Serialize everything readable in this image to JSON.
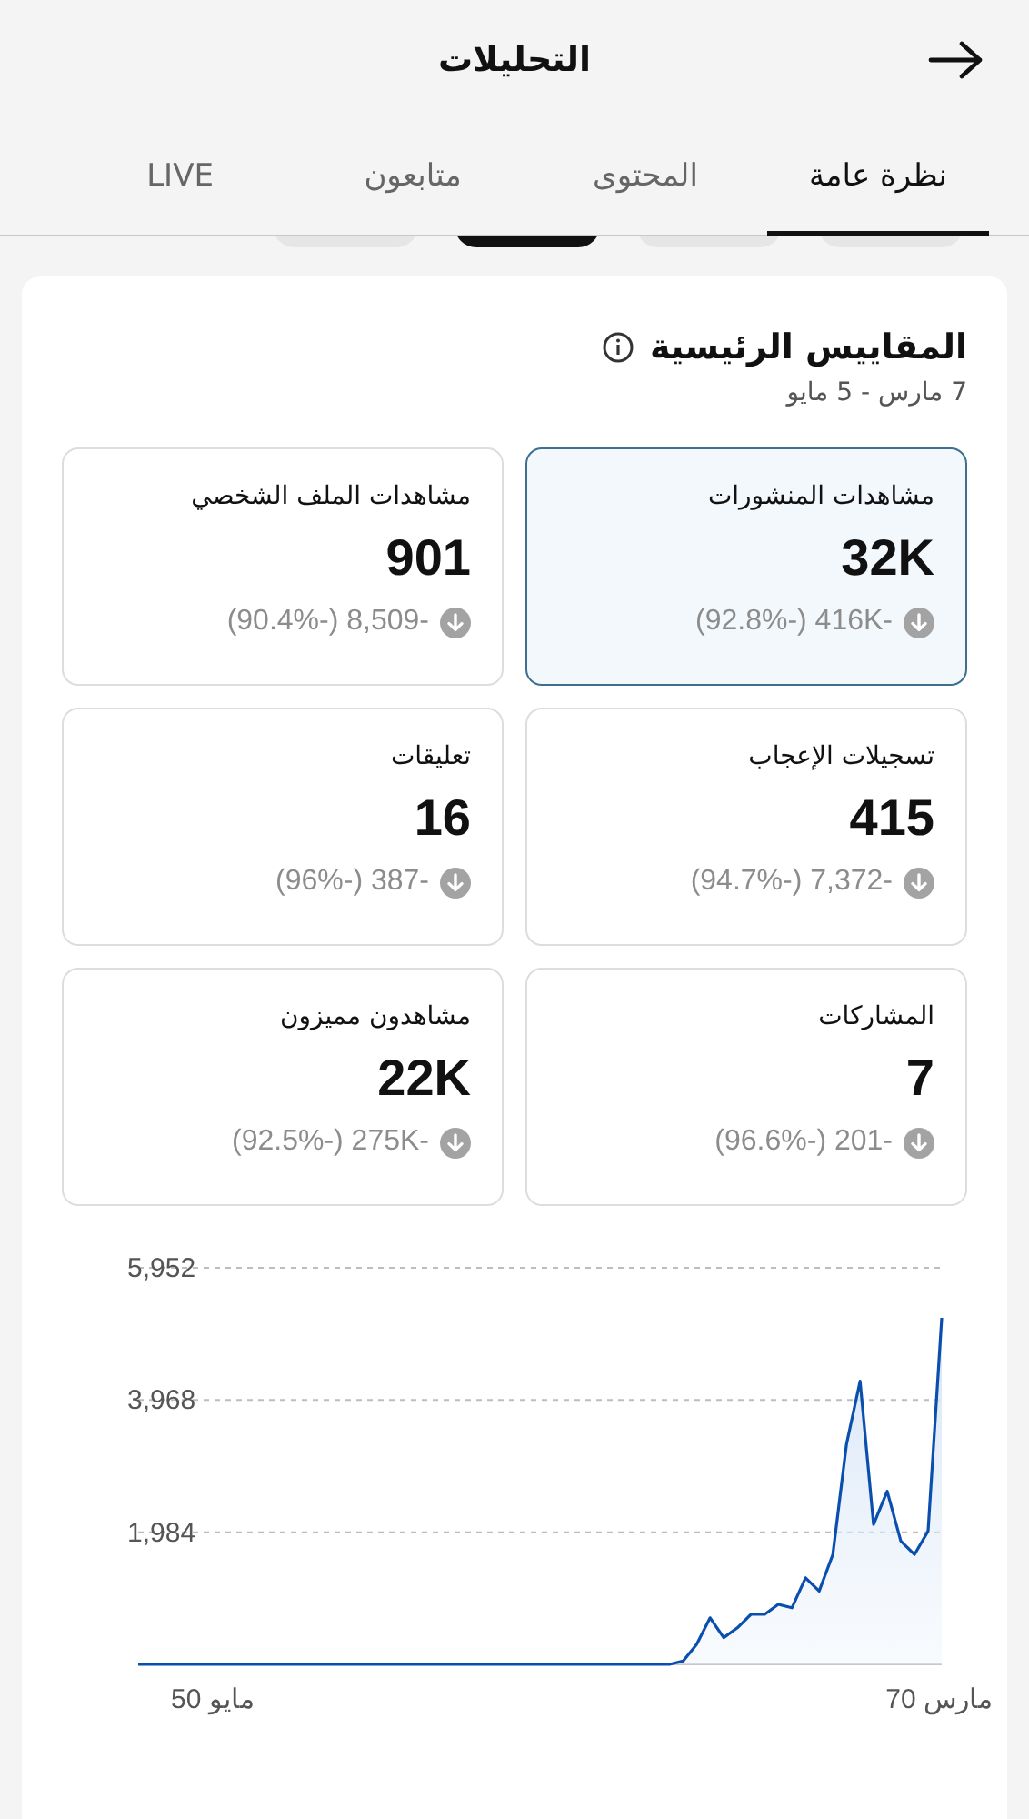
{
  "header": {
    "title": "التحليلات"
  },
  "tabs": [
    {
      "label": "نظرة عامة",
      "selected": true
    },
    {
      "label": "المحتوى",
      "selected": false
    },
    {
      "label": "متابعون",
      "selected": false
    },
    {
      "label": "LIVE",
      "selected": false
    }
  ],
  "filter_chips": [
    {
      "selected": false
    },
    {
      "selected": false
    },
    {
      "selected": true
    },
    {
      "selected": false
    }
  ],
  "key_metrics": {
    "title": "المقاييس الرئيسية",
    "date_range": "7 مارس - 5 مايو",
    "metrics": [
      {
        "label": "مشاهدات المنشورات",
        "value": "32K",
        "change": "(92.8%-) 416K-",
        "selected": true
      },
      {
        "label": "مشاهدات الملف الشخصي",
        "value": "901",
        "change": "(90.4%-) 8,509-",
        "selected": false
      },
      {
        "label": "تسجيلات الإعجاب",
        "value": "415",
        "change": "(94.7%-) 7,372-",
        "selected": false
      },
      {
        "label": "تعليقات",
        "value": "16",
        "change": "(96%-) 387-",
        "selected": false
      },
      {
        "label": "المشاركات",
        "value": "7",
        "change": "(96.6%-) 201-",
        "selected": false
      },
      {
        "label": "مشاهدون مميزون",
        "value": "22K",
        "change": "(92.5%-) 275K-",
        "selected": false
      }
    ]
  },
  "chart": {
    "x_labels": [
      "مارس 70",
      "مايو 50"
    ],
    "chart_data": {
      "type": "line",
      "ylim": [
        0,
        5952
      ],
      "yticks": [
        {
          "value": 1984,
          "label": "1,984"
        },
        {
          "value": 3968,
          "label": "3,968"
        },
        {
          "value": 5952,
          "label": "5,952"
        }
      ],
      "series": [
        {
          "color": "#0a4fae",
          "values": [
            0,
            0,
            0,
            0,
            0,
            0,
            0,
            0,
            0,
            0,
            0,
            0,
            0,
            0,
            0,
            0,
            0,
            0,
            0,
            0,
            0,
            0,
            0,
            0,
            0,
            0,
            0,
            0,
            0,
            0,
            0,
            0,
            0,
            0,
            0,
            0,
            0,
            0,
            0,
            0,
            50,
            300,
            700,
            400,
            550,
            750,
            750,
            900,
            850,
            1300,
            1100,
            1650,
            3300,
            4250,
            2100,
            2600,
            1850,
            1650,
            2000,
            5200
          ]
        }
      ]
    }
  }
}
